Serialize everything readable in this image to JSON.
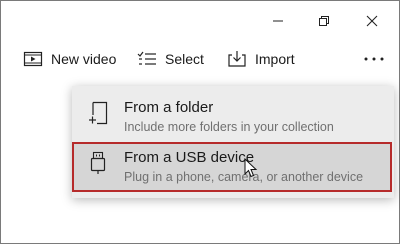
{
  "window_controls": {
    "minimize_icon": "minimize-icon",
    "maximize_icon": "restore-icon",
    "close_icon": "close-icon"
  },
  "toolbar": {
    "new_video_label": "New video",
    "select_label": "Select",
    "import_label": "Import",
    "more_icon": "more-icon"
  },
  "import_menu": {
    "items": [
      {
        "title": "From a folder",
        "subtitle": "Include more folders in your collection",
        "icon": "folder-add-icon"
      },
      {
        "title": "From a USB device",
        "subtitle": "Plug in a phone, camera, or another device",
        "icon": "usb-device-icon",
        "highlighted": true
      }
    ]
  },
  "colors": {
    "menu_background": "#ececec",
    "hover_background": "#d6d6d6",
    "highlight_border": "#b62b2b",
    "subtitle_text": "#707070"
  }
}
